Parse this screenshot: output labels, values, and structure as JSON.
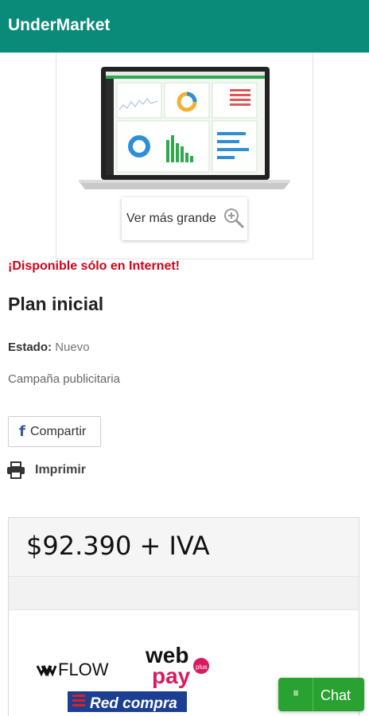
{
  "app": {
    "title": "UnderMarket"
  },
  "product_image": {
    "zoom_label": "Ver más grande",
    "zoom_icon": "magnifier-plus-icon"
  },
  "product": {
    "availability": "¡Disponible sólo en Internet!",
    "title": "Plan inicial",
    "status_label": "Estado:",
    "status_value": "Nuevo",
    "category": "Campaña publicitaria"
  },
  "actions": {
    "share_label": "Compartir",
    "share_icon": "facebook-icon",
    "print_label": "Imprimir",
    "print_icon": "printer-icon"
  },
  "pricing": {
    "price": "$92.390 + IVA"
  },
  "payment": {
    "logos": [
      "FLOW",
      "web",
      "pay",
      "plus",
      "Red compra"
    ]
  },
  "chat": {
    "label": "Chat"
  },
  "colors": {
    "appbar": "#0a8a78",
    "availability": "#d0021b",
    "chat": "#2aa232",
    "facebook": "#3b5998"
  }
}
